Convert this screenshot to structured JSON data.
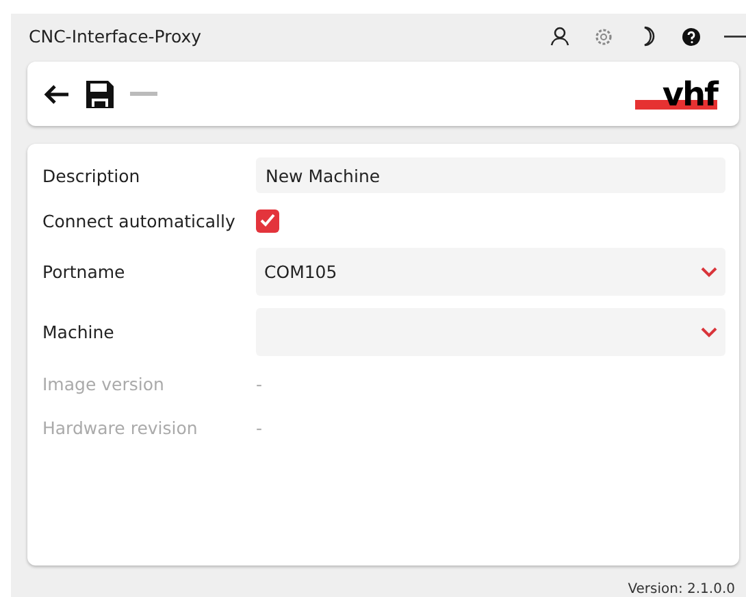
{
  "window": {
    "title": "CNC-Interface-Proxy"
  },
  "toolbar": {
    "logo": "vhf"
  },
  "form": [
    {
      "kind": "text",
      "label": "Description",
      "value": "New Machine"
    },
    {
      "kind": "checkbox",
      "label": "Connect automatically",
      "checked": true
    },
    {
      "kind": "select",
      "label": "Portname",
      "value": "COM105"
    },
    {
      "kind": "select",
      "label": "Machine"
    },
    {
      "kind": "info",
      "label": "Image version",
      "value": "-"
    },
    {
      "kind": "info",
      "label": "Hardware revision",
      "value": "-"
    }
  ],
  "status_bar": {
    "version": "Version: 2.1.0.0"
  }
}
